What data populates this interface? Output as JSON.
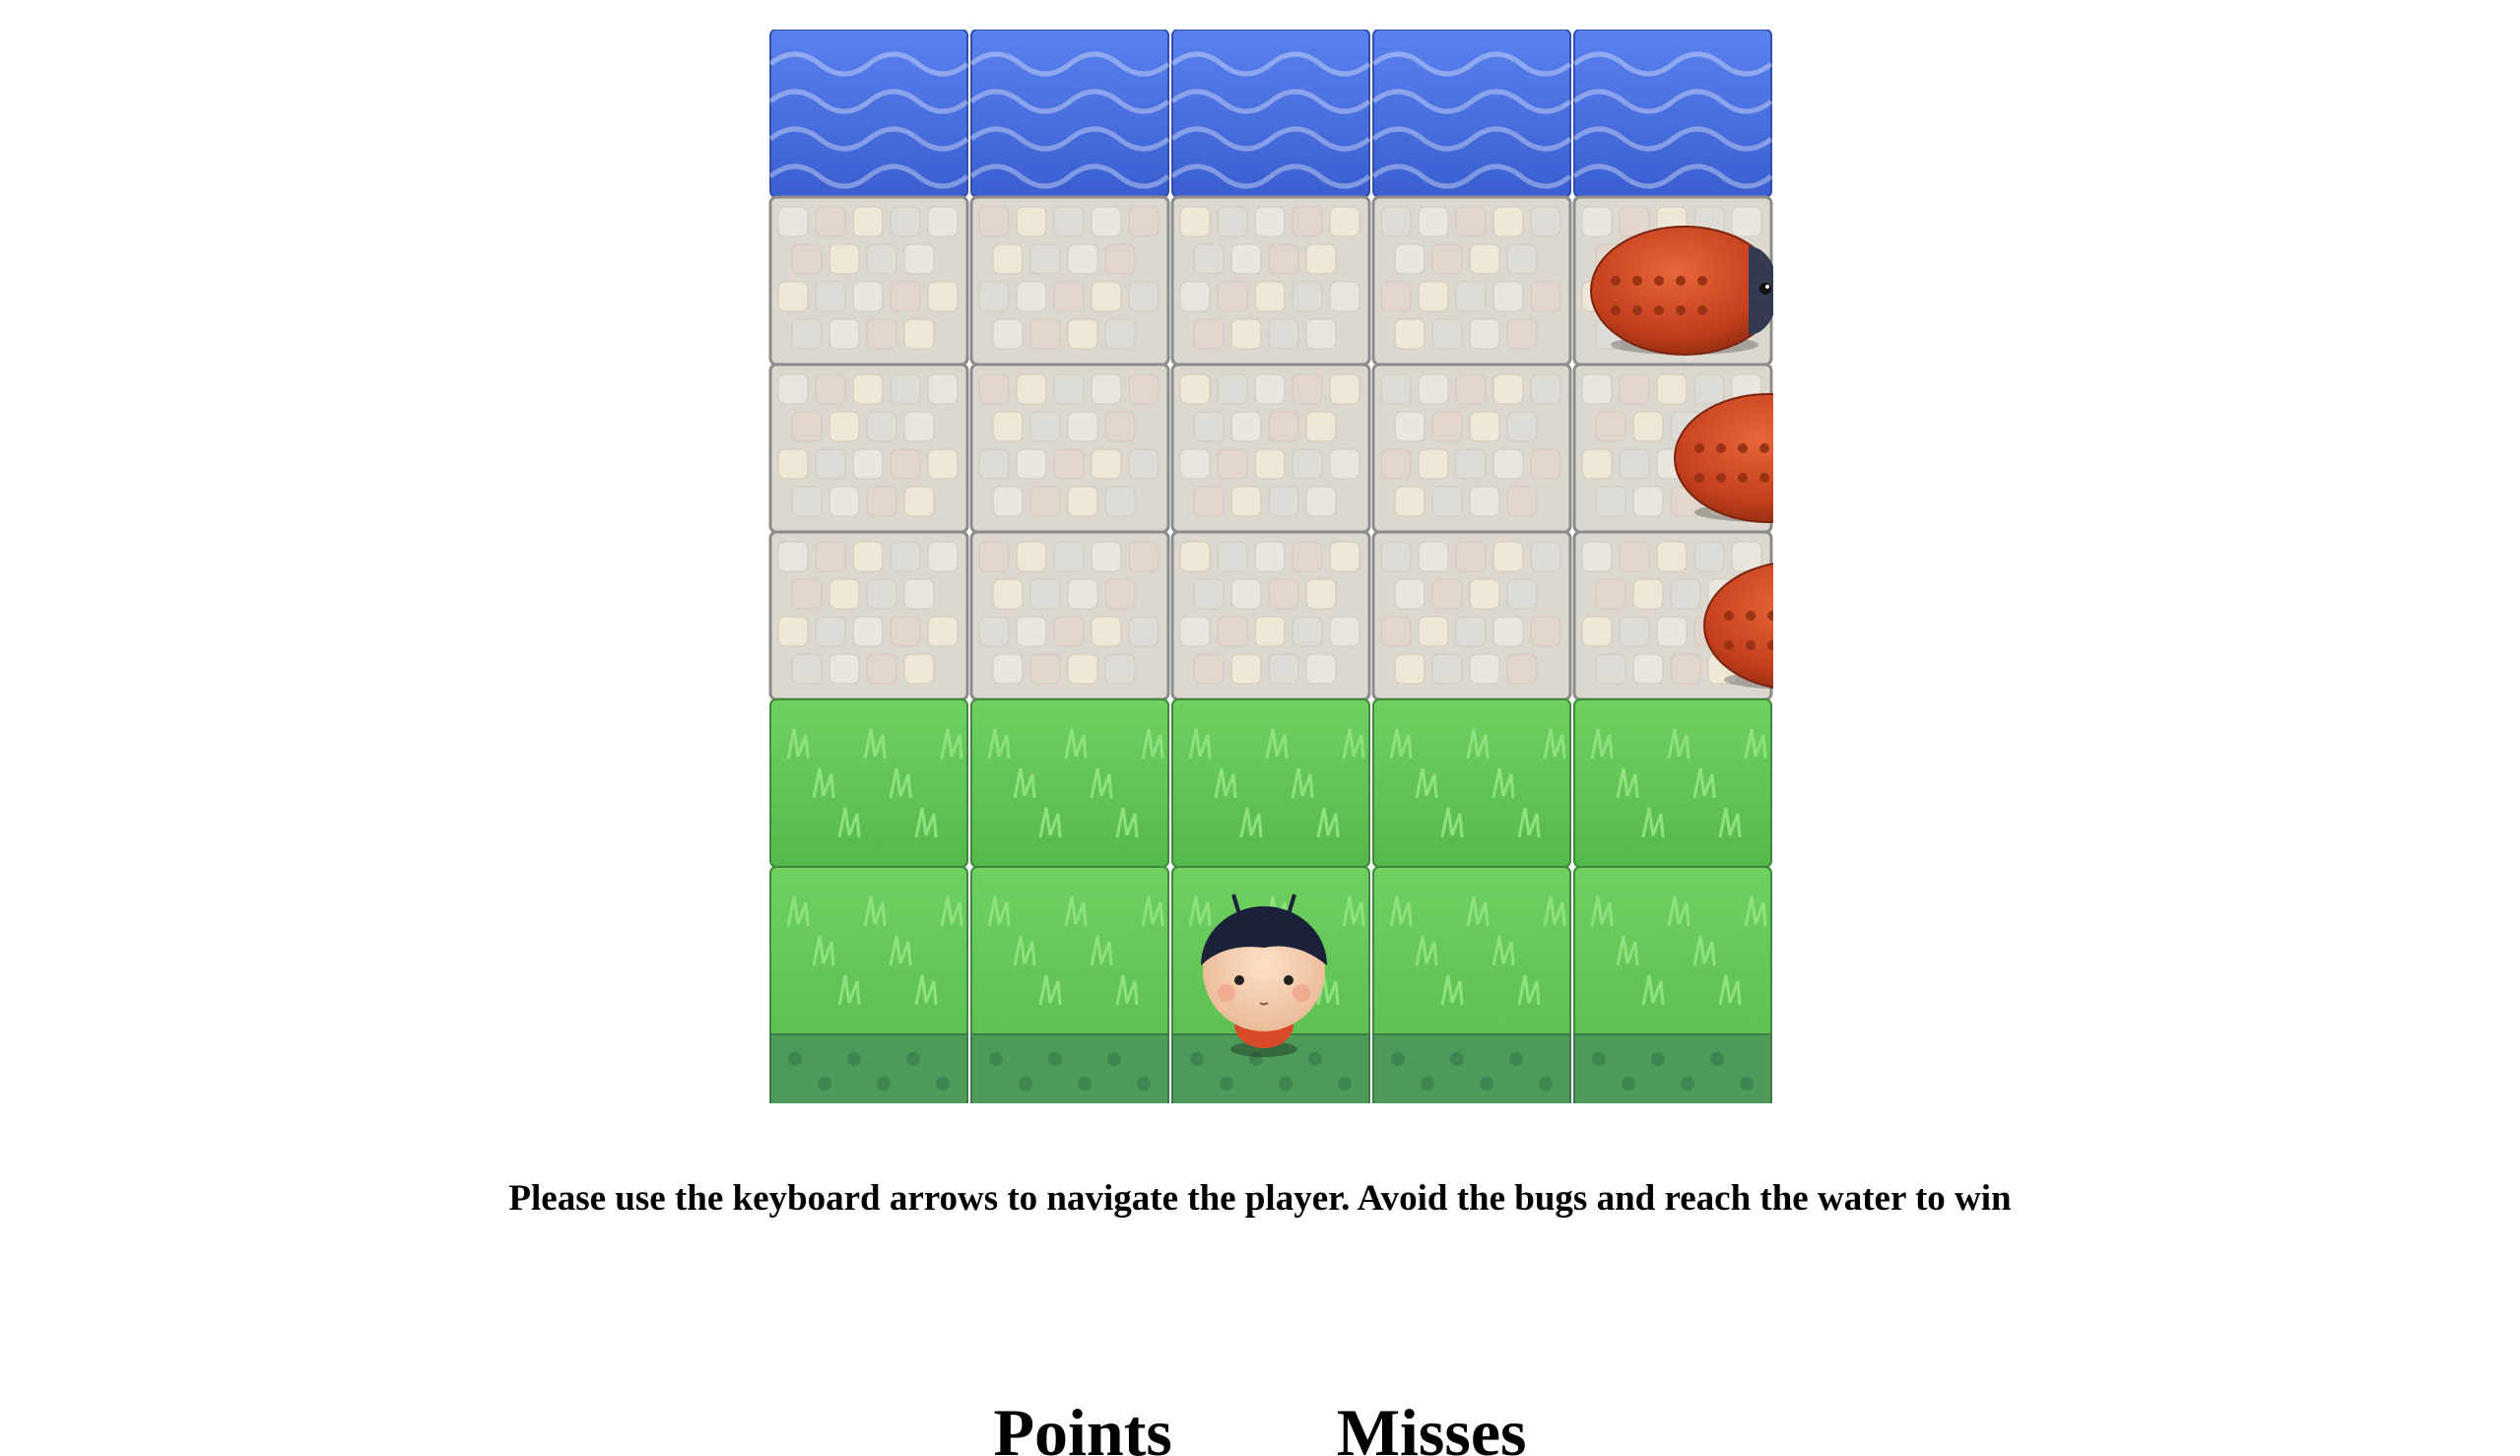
{
  "game": {
    "columns": 5,
    "rows": [
      "water",
      "stone",
      "stone",
      "stone",
      "grass",
      "grass"
    ],
    "enemies": [
      {
        "name": "bug",
        "row": 1
      },
      {
        "name": "bug",
        "row": 2
      },
      {
        "name": "bug",
        "row": 3
      }
    ],
    "player": {
      "name": "boy",
      "row": 5,
      "column": 2
    }
  },
  "instructions": "Please use the keyboard arrows to navigate the player. Avoid the bugs and reach the water to win",
  "scoreboard": {
    "points_label": "Points",
    "misses_label": "Misses"
  },
  "colors": {
    "water": "#4a6fdc",
    "stone": "#dcd8d0",
    "grass": "#62c455",
    "grass_dark": "#4d9a5a",
    "bug": "#c9451f"
  },
  "icons": {
    "enemy": "ladybug-icon",
    "player": "boy-character-icon"
  }
}
